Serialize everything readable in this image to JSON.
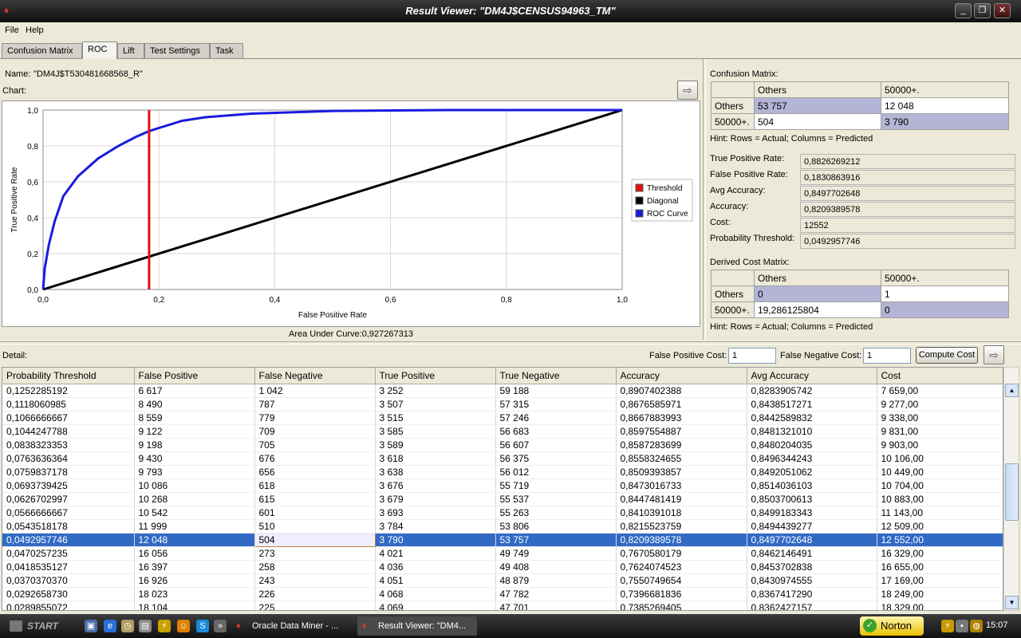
{
  "window": {
    "title": "Result Viewer: \"DM4J$CENSUS94963_TM\""
  },
  "menu": {
    "file": "File",
    "help": "Help"
  },
  "tabs": [
    "Confusion Matrix",
    "ROC",
    "Lift",
    "Test Settings",
    "Task"
  ],
  "left": {
    "name_label": "Name:",
    "name_value": "\"DM4J$T530481668568_R\"",
    "chart_label": "Chart:",
    "auc": "Area Under Curve:0,927267313"
  },
  "chart_data": {
    "type": "line",
    "xlabel": "False Positive Rate",
    "ylabel": "True Positive Rate",
    "xlim": [
      0,
      1
    ],
    "ylim": [
      0,
      1
    ],
    "x_ticks": [
      "0,0",
      "0,2",
      "0,4",
      "0,6",
      "0,8",
      "1,0"
    ],
    "y_ticks": [
      "0,0",
      "0,2",
      "0,4",
      "0,6",
      "0,8",
      "1,0"
    ],
    "grid": true,
    "legend_position": "right",
    "series": [
      {
        "name": "Threshold",
        "color": "#e01010",
        "x": [
          0.1831,
          0.1831
        ],
        "y": [
          0,
          1
        ]
      },
      {
        "name": "Diagonal",
        "color": "#000000",
        "x": [
          0,
          1
        ],
        "y": [
          0,
          1
        ]
      },
      {
        "name": "ROC Curve",
        "color": "#1a1adf",
        "x": [
          0,
          0.003,
          0.01,
          0.02,
          0.035,
          0.06,
          0.095,
          0.13,
          0.16,
          0.1831,
          0.2,
          0.22,
          0.24,
          0.28,
          0.36,
          0.5,
          0.7,
          0.9,
          1.0
        ],
        "y": [
          0,
          0.12,
          0.25,
          0.38,
          0.52,
          0.63,
          0.73,
          0.8,
          0.85,
          0.8826,
          0.9,
          0.92,
          0.94,
          0.96,
          0.98,
          0.995,
          1.0,
          1.0,
          1.0
        ]
      }
    ]
  },
  "confusion": {
    "label": "Confusion Matrix:",
    "col_headers": [
      "Others",
      "50000+."
    ],
    "rows": [
      {
        "header": "Others",
        "cells": [
          "53 757",
          "12 048"
        ]
      },
      {
        "header": "50000+.",
        "cells": [
          "504",
          "3 790"
        ]
      }
    ],
    "hint": "Hint: Rows = Actual; Columns = Predicted"
  },
  "metrics": [
    {
      "label": "True Positive Rate:",
      "value": "0,8826269212"
    },
    {
      "label": "False Positive Rate:",
      "value": "0,1830863916"
    },
    {
      "label": "Avg Accuracy:",
      "value": "0,8497702648"
    },
    {
      "label": "Accuracy:",
      "value": "0,8209389578"
    },
    {
      "label": "Cost:",
      "value": "12552"
    },
    {
      "label": "Probability Threshold:",
      "value": "0,0492957746"
    }
  ],
  "cost_matrix": {
    "label": "Derived Cost Matrix:",
    "col_headers": [
      "Others",
      "50000+."
    ],
    "rows": [
      {
        "header": "Others",
        "cells": [
          "0",
          "1"
        ]
      },
      {
        "header": "50000+.",
        "cells": [
          "19,286125804",
          "0"
        ]
      }
    ],
    "hint": "Hint: Rows = Actual; Columns = Predicted"
  },
  "detail": {
    "label": "Detail:",
    "fp_cost_label": "False Positive Cost:",
    "fp_cost_value": "1",
    "fn_cost_label": "False Negative Cost:",
    "fn_cost_value": "1",
    "compute_button": "Compute Cost",
    "columns": [
      "Probability Threshold",
      "False Positive",
      "False Negative",
      "True Positive",
      "True Negative",
      "Accuracy",
      "Avg Accuracy",
      "Cost"
    ],
    "rows": [
      [
        "0,1252285192",
        "6 617",
        "1 042",
        "3 252",
        "59 188",
        "0,8907402388",
        "0,8283905742",
        "7 659,00"
      ],
      [
        "0,1118060985",
        "8 490",
        "787",
        "3 507",
        "57 315",
        "0,8676585971",
        "0,8438517271",
        "9 277,00"
      ],
      [
        "0,1066666667",
        "8 559",
        "779",
        "3 515",
        "57 246",
        "0,8667883993",
        "0,8442589832",
        "9 338,00"
      ],
      [
        "0,1044247788",
        "9 122",
        "709",
        "3 585",
        "56 683",
        "0,8597554887",
        "0,8481321010",
        "9 831,00"
      ],
      [
        "0,0838323353",
        "9 198",
        "705",
        "3 589",
        "56 607",
        "0,8587283699",
        "0,8480204035",
        "9 903,00"
      ],
      [
        "0,0763636364",
        "9 430",
        "676",
        "3 618",
        "56 375",
        "0,8558324655",
        "0,8496344243",
        "10 106,00"
      ],
      [
        "0,0759837178",
        "9 793",
        "656",
        "3 638",
        "56 012",
        "0,8509393857",
        "0,8492051062",
        "10 449,00"
      ],
      [
        "0,0693739425",
        "10 086",
        "618",
        "3 676",
        "55 719",
        "0,8473016733",
        "0,8514036103",
        "10 704,00"
      ],
      [
        "0,0626702997",
        "10 268",
        "615",
        "3 679",
        "55 537",
        "0,8447481419",
        "0,8503700613",
        "10 883,00"
      ],
      [
        "0,0566666667",
        "10 542",
        "601",
        "3 693",
        "55 263",
        "0,8410391018",
        "0,8499183343",
        "11 143,00"
      ],
      [
        "0,0543518178",
        "11 999",
        "510",
        "3 784",
        "53 806",
        "0,8215523759",
        "0,8494439277",
        "12 509,00"
      ],
      [
        "0,0492957746",
        "12 048",
        "504",
        "3 790",
        "53 757",
        "0,8209389578",
        "0,8497702648",
        "12 552,00"
      ],
      [
        "0,0470257235",
        "16 056",
        "273",
        "4 021",
        "49 749",
        "0,7670580179",
        "0,8462146491",
        "16 329,00"
      ],
      [
        "0,0418535127",
        "16 397",
        "258",
        "4 036",
        "49 408",
        "0,7624074523",
        "0,8453702838",
        "16 655,00"
      ],
      [
        "0,0370370370",
        "16 926",
        "243",
        "4 051",
        "48 879",
        "0,7550749654",
        "0,8430974555",
        "17 169,00"
      ],
      [
        "0,0292658730",
        "18 023",
        "226",
        "4 068",
        "47 782",
        "0,7396681836",
        "0,8367417290",
        "18 249,00"
      ],
      [
        "0,0289855072",
        "18 104",
        "225",
        "4 069",
        "47 701",
        "0,7385269405",
        "0,8362427157",
        "18 329,00"
      ]
    ],
    "selected_row": 11
  },
  "taskbar": {
    "start": "START",
    "items": [
      "Oracle Data Miner - ...",
      "Result Viewer: \"DM4..."
    ],
    "norton": "Norton",
    "clock": "15:07"
  }
}
